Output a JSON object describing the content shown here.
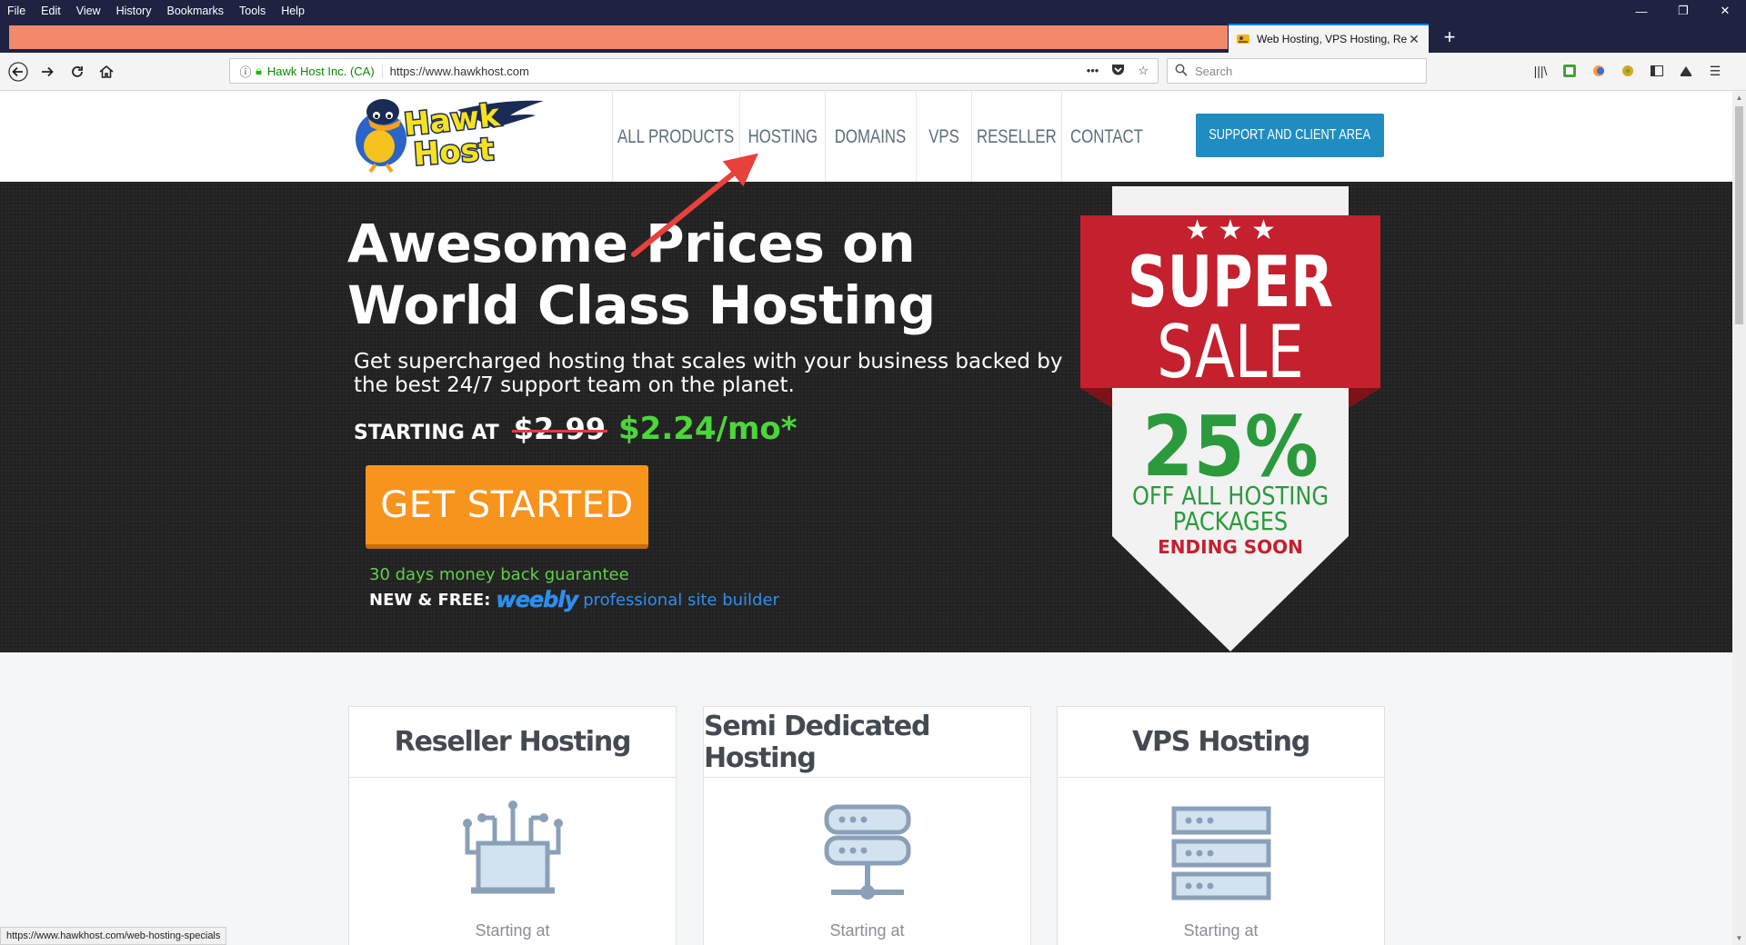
{
  "browser": {
    "menu": [
      "File",
      "Edit",
      "View",
      "History",
      "Bookmarks",
      "Tools",
      "Help"
    ],
    "window_controls": [
      "—",
      "❐",
      "✕"
    ],
    "tab_title": "Web Hosting, VPS Hosting, Res",
    "new_tab": "+",
    "identity": "Hawk Host Inc. (CA)",
    "url": "https://www.hawkhost.com",
    "search_placeholder": "Search",
    "status_url": "https://www.hawkhost.com/web-hosting-specials"
  },
  "site": {
    "logo_text": "Hawk Host",
    "nav": [
      "ALL PRODUCTS",
      "HOSTING",
      "DOMAINS",
      "VPS",
      "RESELLER",
      "CONTACT"
    ],
    "support_button": "SUPPORT AND CLIENT AREA"
  },
  "hero": {
    "title": "Awesome Prices on World Class Hosting",
    "subtitle": "Get supercharged hosting that scales with your business backed by the best 24/7 support team on the planet.",
    "starting_at": "STARTING AT",
    "old_price": "$2.99",
    "new_price": "$2.24/mo*",
    "cta": "GET STARTED",
    "guarantee": "30 days money back guarantee",
    "new_free": "NEW & FREE:",
    "weebly": "weebly",
    "site_builder": "professional site builder"
  },
  "sale_badge": {
    "stars": "★ ★ ★",
    "super": "SUPER",
    "sale": "SALE",
    "percent": "25%",
    "line1": "OFF ALL HOSTING",
    "line2": "PACKAGES",
    "ending": "ENDING SOON"
  },
  "cards": [
    {
      "title": "Reseller Hosting",
      "starting": "Starting at"
    },
    {
      "title": "Semi Dedicated Hosting",
      "starting": "Starting at"
    },
    {
      "title": "VPS Hosting",
      "starting": "Starting at"
    }
  ],
  "colors": {
    "accent_blue": "#1f8dc1",
    "cta_orange": "#f7941d",
    "price_green": "#4cd63a",
    "sale_red": "#c4202e",
    "sale_green": "#2b9a3c"
  }
}
